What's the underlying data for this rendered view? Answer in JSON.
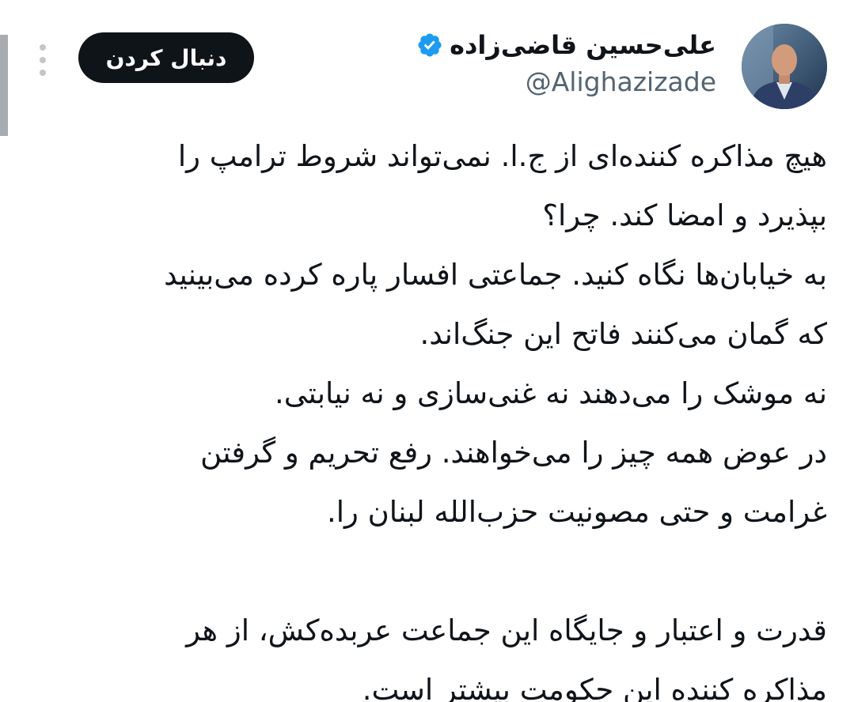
{
  "author": {
    "display_name": "علی‌حسین قاضی‌زاده",
    "handle": "@Alighazizade",
    "verified": true,
    "verified_badge_color": "#1d9bf0",
    "avatar_icon": "user-avatar-photo"
  },
  "actions": {
    "follow_label": "دنبال کردن",
    "more_icon": "more-vertical-icon"
  },
  "tweet": {
    "lines": [
      "هیچ مذاکره کننده‌ای از ج.ا. نمی‌تواند شروط ترامپ را",
      "بپذیرد و امضا کند. چرا؟",
      "به خیابان‌ها نگاه کنید. جماعتی افسار پاره کرده می‌بینید",
      "که گمان می‌کنند فاتح این جنگ‌اند.",
      "نه موشک را می‌دهند نه غنی‌سازی و نه نیابتی.",
      "در عوض همه چیز را می‌خواهند. رفع تحریم و گرفتن",
      "غرامت و حتی مصونیت حزب‌الله لبنان را.",
      "",
      "قدرت و اعتبار و جایگاه این جماعت عربده‌کش، از هر",
      "مذاکره کننده این حکومت بیشتر است."
    ]
  }
}
